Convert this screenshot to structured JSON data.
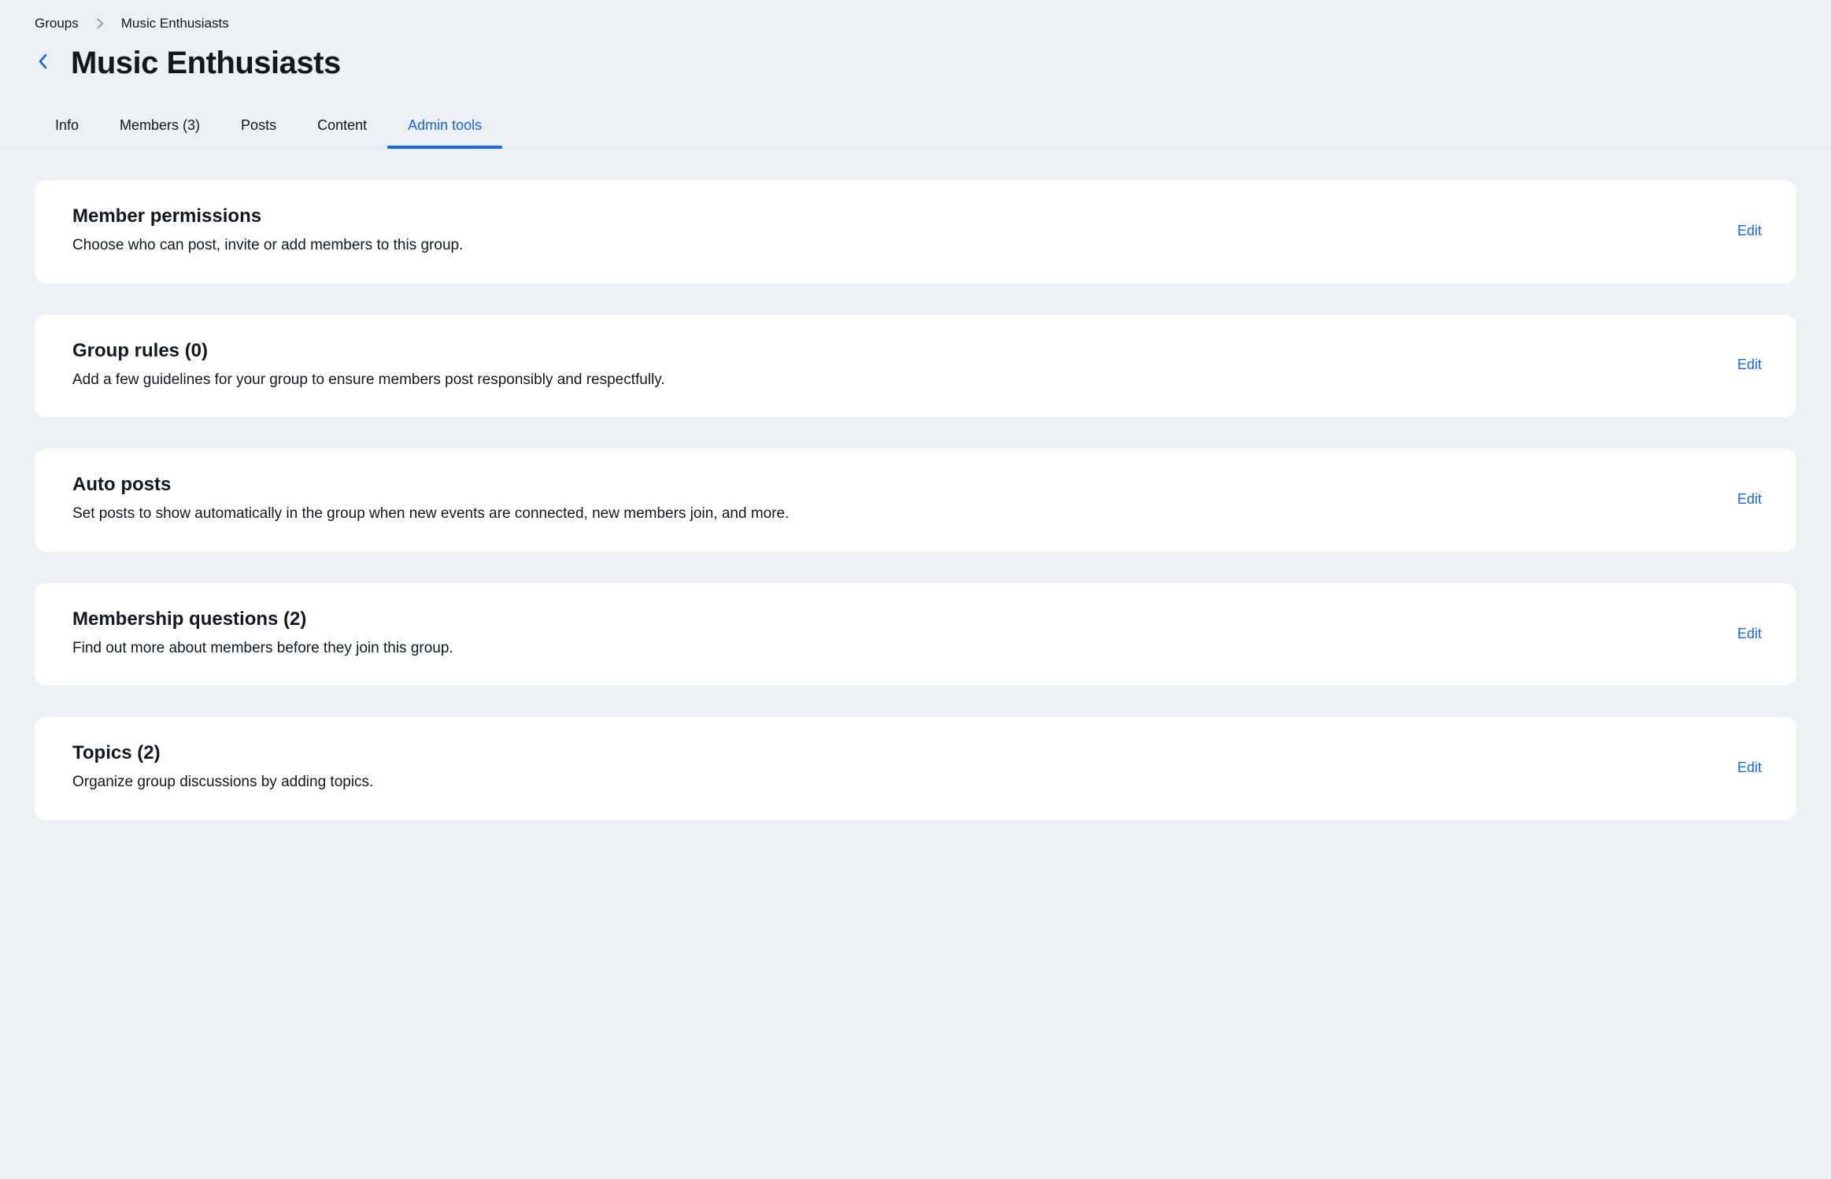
{
  "breadcrumb": {
    "root": "Groups",
    "current": "Music Enthusiasts"
  },
  "header": {
    "title": "Music Enthusiasts"
  },
  "tabs": {
    "info": "Info",
    "members": "Members (3)",
    "posts": "Posts",
    "content": "Content",
    "admin_tools": "Admin tools"
  },
  "sections": {
    "member_permissions": {
      "title": "Member permissions",
      "desc": "Choose who can post, invite or add members to this group.",
      "action": "Edit"
    },
    "group_rules": {
      "title": "Group rules (0)",
      "desc": "Add a few guidelines for your group to ensure members post responsibly and respectfully.",
      "action": "Edit"
    },
    "auto_posts": {
      "title": "Auto posts",
      "desc": "Set posts to show automatically in the group when new events are connected, new members join, and more.",
      "action": "Edit"
    },
    "membership_questions": {
      "title": "Membership questions (2)",
      "desc": "Find out more about members before they join this group.",
      "action": "Edit"
    },
    "topics": {
      "title": "Topics (2)",
      "desc": "Organize group discussions by adding topics.",
      "action": "Edit"
    }
  }
}
